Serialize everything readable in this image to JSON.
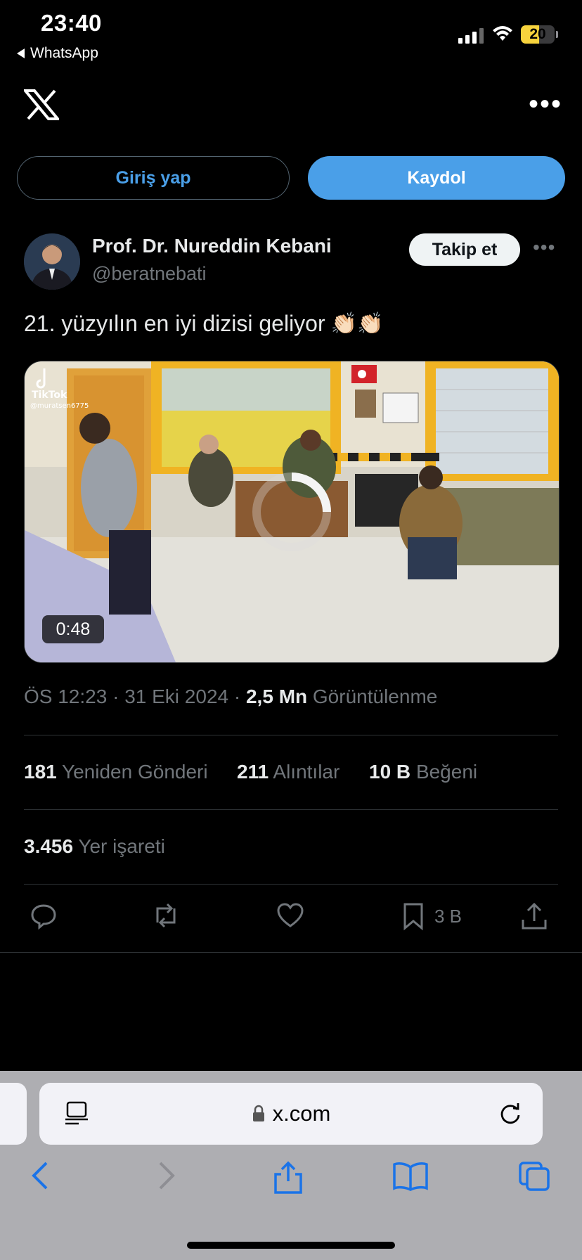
{
  "status_bar": {
    "time": "23:40",
    "back_app": "WhatsApp",
    "battery": "20",
    "battery_color": "#f7d33d"
  },
  "header": {
    "logo": "X",
    "more_icon": "more-horizontal-icon"
  },
  "auth": {
    "login_label": "Giriş yap",
    "signup_label": "Kaydol",
    "accent": "#4a9fe8"
  },
  "post": {
    "author_name": "Prof. Dr. Nureddin Kebani",
    "author_handle": "@beratnebati",
    "follow_label": "Takip et",
    "text": "21. yüzyılın en iyi dizisi geliyor",
    "emoji": "👏🏻👏🏻",
    "media": {
      "watermark": "TikTok",
      "watermark_user": "@muratsen6775",
      "duration": "0:48"
    },
    "time": "ÖS 12:23",
    "date": "31 Eki 2024",
    "views_value": "2,5 Mn",
    "views_label": "Görüntülenme",
    "stats": {
      "reposts_value": "181",
      "reposts_label": "Yeniden Gönderi",
      "quotes_value": "211",
      "quotes_label": "Alıntılar",
      "likes_value": "10 B",
      "likes_label": "Beğeni",
      "bookmarks_value": "3.456",
      "bookmarks_label": "Yer işareti"
    },
    "actions": {
      "bookmark_count": "3 B"
    }
  },
  "browser": {
    "url": "x.com"
  }
}
